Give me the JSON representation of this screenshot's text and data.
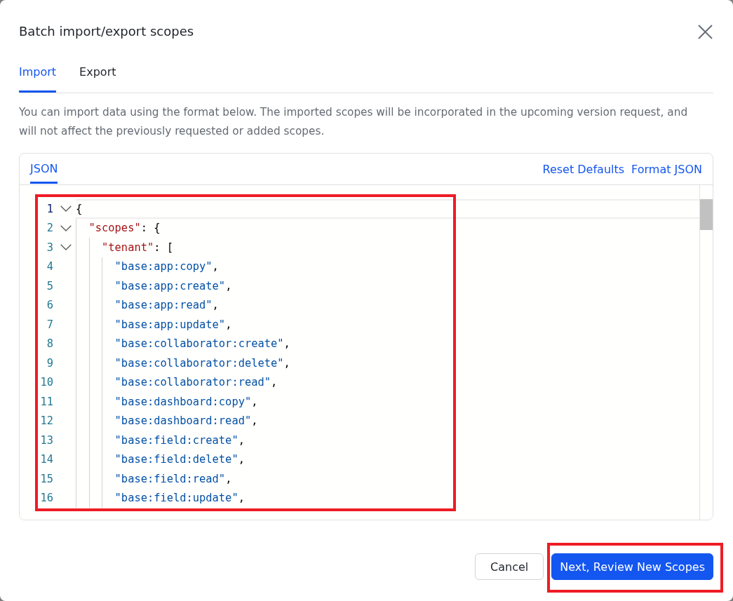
{
  "dialog": {
    "title": "Batch import/export scopes"
  },
  "tabs": [
    {
      "label": "Import",
      "selected": true
    },
    {
      "label": "Export",
      "selected": false
    }
  ],
  "description": "You can import data using the format below. The imported scopes will be incorporated in the upcoming version request, and will not affect the previously requested or added scopes.",
  "editor": {
    "tabs": [
      {
        "label": "JSON",
        "selected": true
      }
    ],
    "actions": [
      "Reset Defaults",
      "Format JSON"
    ],
    "highlighted": true,
    "lines": [
      {
        "number": "1",
        "active": true,
        "expanded": true,
        "tokens": [
          {
            "kind": "punct",
            "text": "{"
          }
        ],
        "children": [
          {
            "number": "2",
            "active": false,
            "expanded": true,
            "tokens": [
              {
                "kind": "key",
                "text": "\"scopes\""
              },
              {
                "kind": "punct",
                "text": ": {"
              }
            ],
            "children": [
              {
                "number": "3",
                "active": false,
                "expanded": true,
                "tokens": [
                  {
                    "kind": "key",
                    "text": "\"tenant\""
                  },
                  {
                    "kind": "punct",
                    "text": ": ["
                  }
                ],
                "children": [
                  {
                    "number": "4",
                    "active": false,
                    "tokens": [
                      {
                        "kind": "string",
                        "text": "\"base:app:copy\""
                      },
                      {
                        "kind": "punct",
                        "text": ","
                      }
                    ]
                  },
                  {
                    "number": "5",
                    "active": false,
                    "tokens": [
                      {
                        "kind": "string",
                        "text": "\"base:app:create\""
                      },
                      {
                        "kind": "punct",
                        "text": ","
                      }
                    ]
                  },
                  {
                    "number": "6",
                    "active": false,
                    "tokens": [
                      {
                        "kind": "string",
                        "text": "\"base:app:read\""
                      },
                      {
                        "kind": "punct",
                        "text": ","
                      }
                    ]
                  },
                  {
                    "number": "7",
                    "active": false,
                    "tokens": [
                      {
                        "kind": "string",
                        "text": "\"base:app:update\""
                      },
                      {
                        "kind": "punct",
                        "text": ","
                      }
                    ]
                  },
                  {
                    "number": "8",
                    "active": false,
                    "tokens": [
                      {
                        "kind": "string",
                        "text": "\"base:collaborator:create\""
                      },
                      {
                        "kind": "punct",
                        "text": ","
                      }
                    ]
                  },
                  {
                    "number": "9",
                    "active": false,
                    "tokens": [
                      {
                        "kind": "string",
                        "text": "\"base:collaborator:delete\""
                      },
                      {
                        "kind": "punct",
                        "text": ","
                      }
                    ]
                  },
                  {
                    "number": "10",
                    "active": false,
                    "tokens": [
                      {
                        "kind": "string",
                        "text": "\"base:collaborator:read\""
                      },
                      {
                        "kind": "punct",
                        "text": ","
                      }
                    ]
                  },
                  {
                    "number": "11",
                    "active": false,
                    "tokens": [
                      {
                        "kind": "string",
                        "text": "\"base:dashboard:copy\""
                      },
                      {
                        "kind": "punct",
                        "text": ","
                      }
                    ]
                  },
                  {
                    "number": "12",
                    "active": false,
                    "tokens": [
                      {
                        "kind": "string",
                        "text": "\"base:dashboard:read\""
                      },
                      {
                        "kind": "punct",
                        "text": ","
                      }
                    ]
                  },
                  {
                    "number": "13",
                    "active": false,
                    "tokens": [
                      {
                        "kind": "string",
                        "text": "\"base:field:create\""
                      },
                      {
                        "kind": "punct",
                        "text": ","
                      }
                    ]
                  },
                  {
                    "number": "14",
                    "active": false,
                    "tokens": [
                      {
                        "kind": "string",
                        "text": "\"base:field:delete\""
                      },
                      {
                        "kind": "punct",
                        "text": ","
                      }
                    ]
                  },
                  {
                    "number": "15",
                    "active": false,
                    "tokens": [
                      {
                        "kind": "string",
                        "text": "\"base:field:read\""
                      },
                      {
                        "kind": "punct",
                        "text": ","
                      }
                    ]
                  },
                  {
                    "number": "16",
                    "active": false,
                    "tokens": [
                      {
                        "kind": "string",
                        "text": "\"base:field:update\""
                      },
                      {
                        "kind": "punct",
                        "text": ","
                      }
                    ]
                  }
                ]
              }
            ]
          }
        ]
      }
    ]
  },
  "footer": {
    "buttons": [
      {
        "label": "Cancel",
        "kind": "secondary",
        "highlighted": false
      },
      {
        "label": "Next, Review New Scopes",
        "kind": "primary",
        "highlighted": true
      }
    ]
  }
}
